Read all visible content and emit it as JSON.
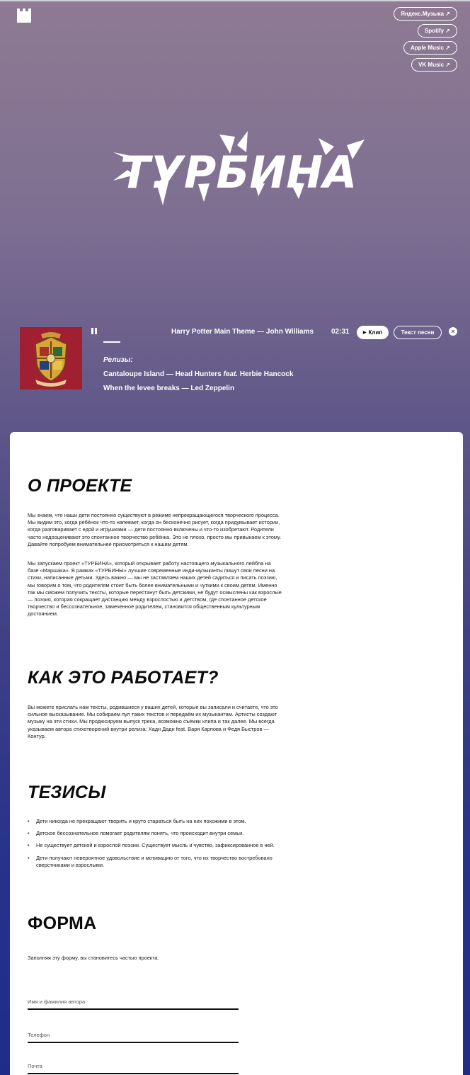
{
  "header": {
    "links": [
      {
        "label": "Яндекс.Музыка ↗"
      },
      {
        "label": "Spotify ↗"
      },
      {
        "label": "Apple Music ↗"
      },
      {
        "label": "VK Music ↗"
      }
    ]
  },
  "hero": {
    "title": "ТУРБИНА"
  },
  "player": {
    "track": "Harry Potter Main Theme — John Williams",
    "time": "02:31",
    "clip_label": "Клип",
    "lyrics_label": "Текст песни",
    "releases_label": "Релизы:",
    "releases": [
      {
        "title": "Cantaloupe Island — Head Hunters ",
        "feat": "feat.",
        "rest": " Herbie Hancock"
      },
      {
        "title": "When the levee breaks — Led Zeppelin"
      }
    ],
    "progress": 0.07
  },
  "about": {
    "title": "О ПРОЕКТЕ",
    "p1": "Мы знаем, что наши дети постоянно существуют в режиме непрекращающегося творческого процесса. Мы видим это, когда ребёнок что-то напевает, когда он бесконечно рисует, когда придумывает истории, когда разговаривает с едой и игрушками — дети постоянно включены и что-то изобретают. Родители часто недооценивают это спонтанное творчество ребёнка. Это не плохо, просто мы привыкаем к этому. Давайте попробуем внимательнее присмотреться к нашим детям.",
    "p2": "Мы запускаем проект «ТУРБИНА», который открывает работу настоящего музыкального лейбла на базе «Маршака». В рамках «ТУРБИНЫ» лучшие современные инди-музыканты пишут свои песни на стихи, написанные детьми. Здесь важно — мы не заставляем наших детей садиться и писать поэзию, мы говорим о том, что родителям стоит быть более внимательными и чуткими к своим детям. Именно так мы сможем получить тексты, которые перестанут быть детскими, не будут осмыслены как взрослые — поэзия, которая сокращает дистанцию между взрослостью и детством, где спонтанное детское творчество и бессознательное, замеченное родителем, становится общественным культурным достоянием."
  },
  "how": {
    "title": "КАК ЭТО РАБОТАЕТ?",
    "p1": "Вы можете прислать нам тексты, родившиеся у ваших детей, которые вы записали и считаете, что это сильное высказывание. Мы собираем пул таких текстов и передаём их музыкантам. Артисты создают музыку на эти стихи. Мы продюсируем выпуск трека, возможно съёмки клипа и так далее. Мы всегда указываем автора стихотворений внутри релиза: Хадн Дадн feat. Варя Карпова и Федя Быстров — Контур."
  },
  "theses": {
    "title": "ТЕЗИСЫ",
    "items": [
      "Дети никогда не прекращают творить и круто стараться быть на них похожими в этом.",
      "Детское бессознательное помогает родителям понять, что происходит внутри семьи.",
      "Не существует детской и взрослой поэзии. Существует мысль и чувство, зафиксированное в ней.",
      "Дети получают невероятное удовольствие и мотивацию от того, что их творчество востребовано сверстниками и взрослыми."
    ]
  },
  "form": {
    "title": "ФОРМА",
    "intro": "Заполняя эту форму, вы становитесь частью проекта.",
    "fields": [
      {
        "placeholder": "Имя и фамилия автора",
        "value": ""
      },
      {
        "placeholder": "Телефон",
        "value": ""
      },
      {
        "placeholder": "Почта",
        "value": ""
      }
    ]
  },
  "colors": {
    "card": "#ffffff",
    "cover": "#a01f30",
    "gradient_top": "#8e7a92",
    "gradient_bottom": "#1f2d88"
  }
}
